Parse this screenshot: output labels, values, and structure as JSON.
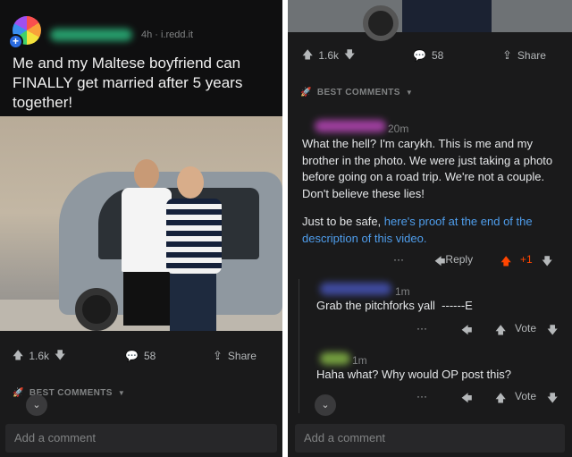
{
  "post": {
    "meta": "4h · i.redd.it",
    "title": "Me and my Maltese boyfriend can FINALLY get married after 5 years together!",
    "upvotes": "1.6k",
    "comments": "58",
    "share_label": "Share"
  },
  "best_comments_label": "BEST COMMENTS",
  "add_comment_placeholder": "Add a comment",
  "comments": [
    {
      "time": "20m",
      "text": "What the hell? I'm carykh. This is me and my brother in the photo. We were just taking a photo before going on a road trip. We're not a couple. Don't believe these lies!",
      "text2_prefix": "Just to be safe, ",
      "link": "here's proof at the end of the description of this video.",
      "reply_label": "Reply",
      "score": "+1"
    },
    {
      "time": "1m",
      "text": "Grab the pitchforks yall  ------E",
      "vote_label": "Vote"
    },
    {
      "time": "1m",
      "text": "Haha what? Why would OP post this?",
      "vote_label": "Vote"
    }
  ],
  "icons": {
    "upvote": "arrow-up-icon",
    "downvote": "arrow-down-icon",
    "comment": "speech-bubble-icon",
    "share": "share-icon",
    "more": "ellipsis-icon",
    "reply": "reply-arrow-icon",
    "best": "rocket-icon",
    "expand": "double-chevron-down-icon"
  },
  "colors": {
    "background": "#1a1a1b",
    "link": "#4f9eed",
    "upvote_active": "#ff4500"
  }
}
